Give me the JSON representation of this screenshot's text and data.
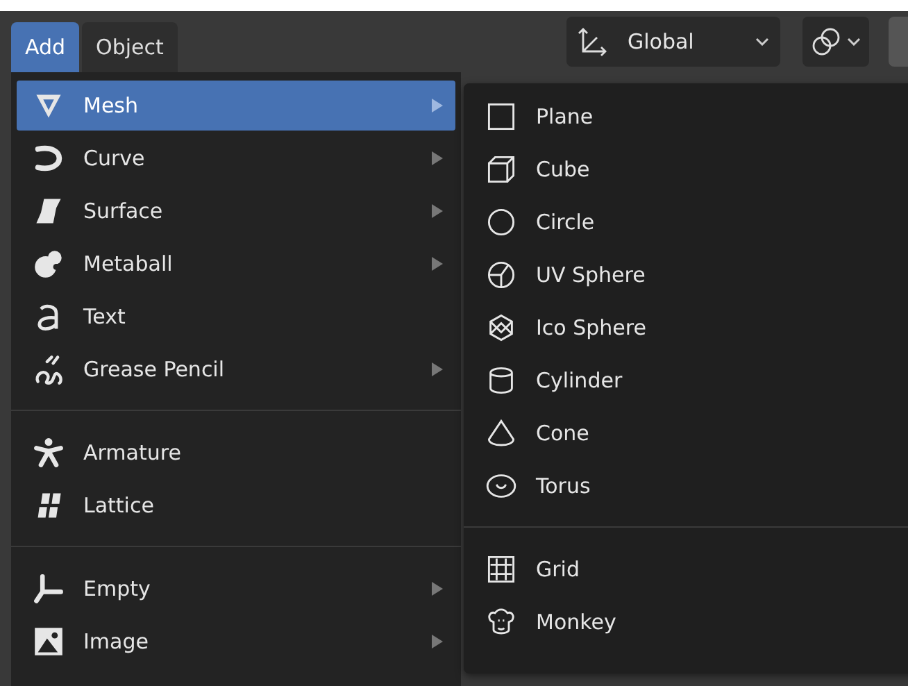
{
  "header": {
    "tabs": [
      {
        "label": "Add",
        "selected": true
      },
      {
        "label": "Object",
        "selected": false
      }
    ],
    "orientation_dropdown": {
      "value": "Global"
    }
  },
  "add_menu": {
    "sections": [
      {
        "items": [
          {
            "label": "Mesh",
            "has_submenu": true,
            "selected": true
          },
          {
            "label": "Curve",
            "has_submenu": true,
            "selected": false
          },
          {
            "label": "Surface",
            "has_submenu": true,
            "selected": false
          },
          {
            "label": "Metaball",
            "has_submenu": true,
            "selected": false
          },
          {
            "label": "Text",
            "has_submenu": false,
            "selected": false
          },
          {
            "label": "Grease Pencil",
            "has_submenu": true,
            "selected": false
          }
        ]
      },
      {
        "items": [
          {
            "label": "Armature",
            "has_submenu": false,
            "selected": false
          },
          {
            "label": "Lattice",
            "has_submenu": false,
            "selected": false
          }
        ]
      },
      {
        "items": [
          {
            "label": "Empty",
            "has_submenu": true,
            "selected": false
          },
          {
            "label": "Image",
            "has_submenu": true,
            "selected": false
          }
        ]
      }
    ]
  },
  "mesh_submenu": {
    "sections": [
      {
        "items": [
          {
            "label": "Plane"
          },
          {
            "label": "Cube"
          },
          {
            "label": "Circle"
          },
          {
            "label": "UV Sphere"
          },
          {
            "label": "Ico Sphere"
          },
          {
            "label": "Cylinder"
          },
          {
            "label": "Cone"
          },
          {
            "label": "Torus"
          }
        ]
      },
      {
        "items": [
          {
            "label": "Grid"
          },
          {
            "label": "Monkey"
          }
        ]
      }
    ]
  }
}
